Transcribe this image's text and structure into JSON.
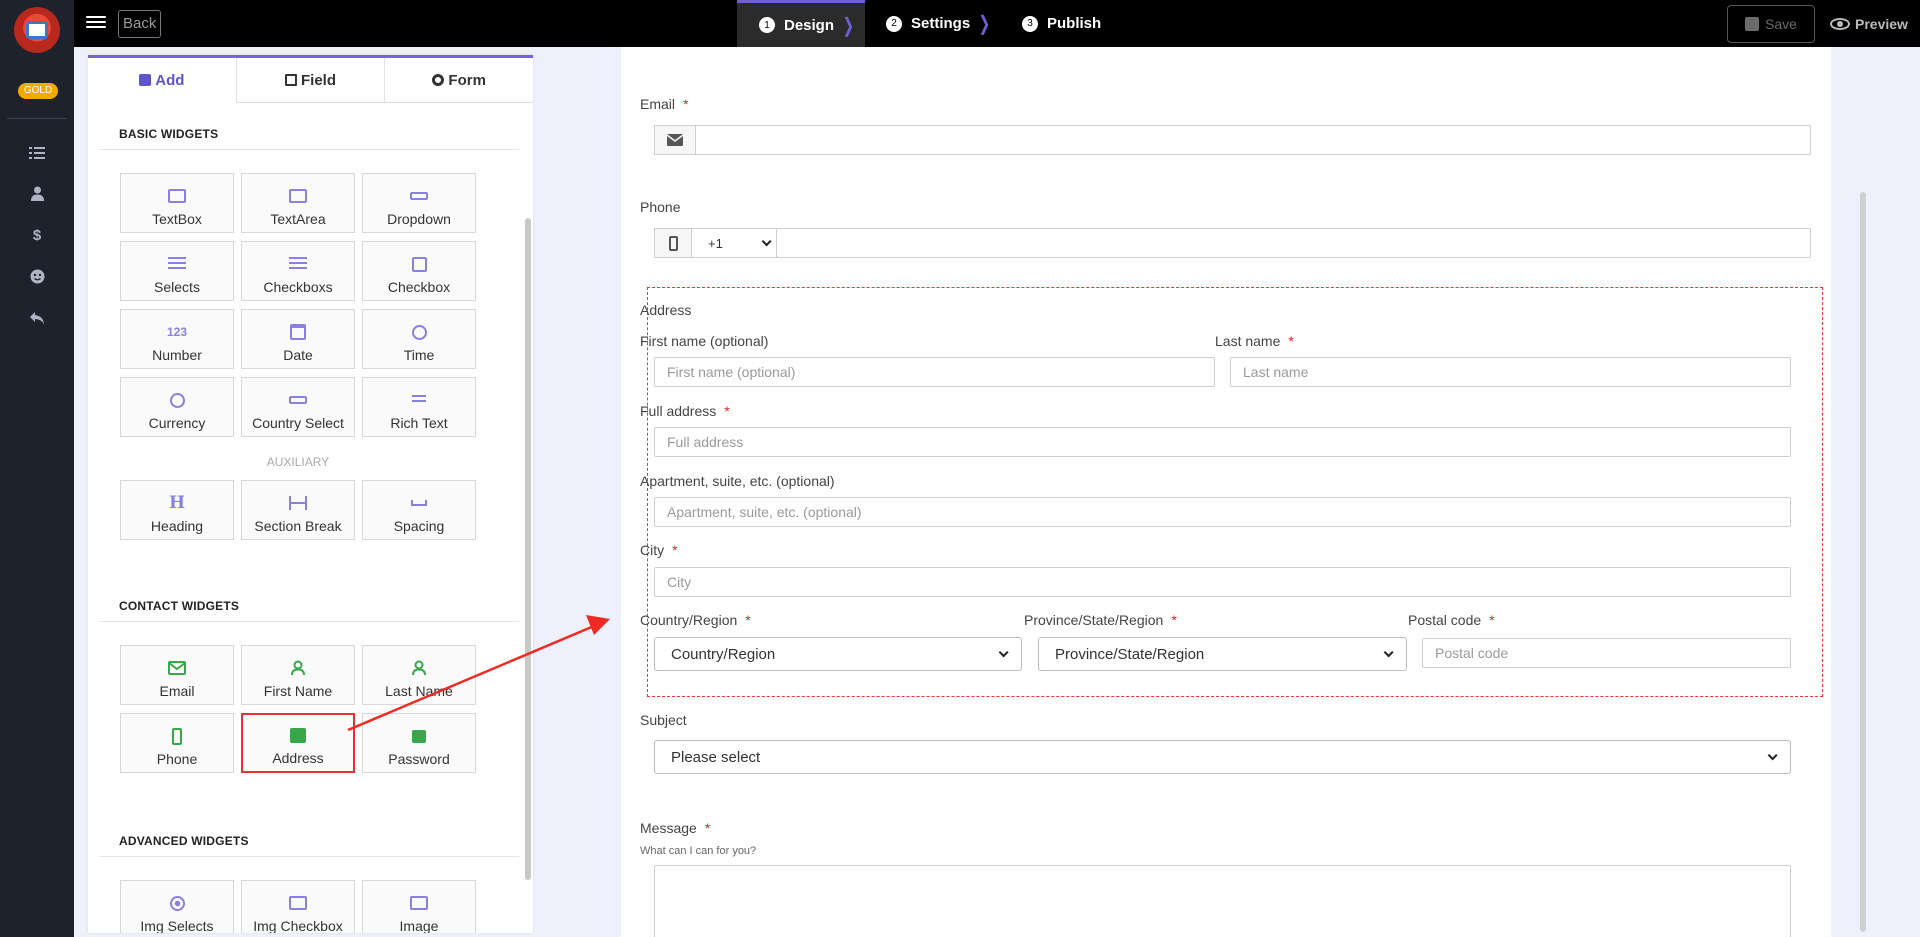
{
  "topbar": {
    "back_label": "Back",
    "steps": [
      {
        "num": "1",
        "label": "Design"
      },
      {
        "num": "2",
        "label": "Settings"
      },
      {
        "num": "3",
        "label": "Publish"
      }
    ],
    "save_label": "Save",
    "preview_label": "Preview"
  },
  "rail": {
    "badge": "GOLD",
    "icons": [
      "list-icon",
      "user-icon",
      "dollar-icon",
      "smile-icon",
      "undo-icon"
    ]
  },
  "panel": {
    "tabs": [
      "Add",
      "Field",
      "Form"
    ],
    "basic_heading": "BASIC WIDGETS",
    "basic_widgets": [
      "TextBox",
      "TextArea",
      "Dropdown",
      "Selects",
      "Checkboxs",
      "Checkbox",
      "Number",
      "Date",
      "Time",
      "Currency",
      "Country Select",
      "Rich Text"
    ],
    "number_glyph": "123",
    "auxiliary_heading": "AUXILIARY",
    "auxiliary_widgets": [
      "Heading",
      "Section Break",
      "Spacing"
    ],
    "heading_glyph": "H",
    "contact_heading": "CONTACT WIDGETS",
    "contact_widgets": [
      "Email",
      "First Name",
      "Last Name",
      "Phone",
      "Address",
      "Password"
    ],
    "advanced_heading": "ADVANCED WIDGETS",
    "advanced_widgets": [
      "Img Selects",
      "Img Checkbox",
      "Image"
    ]
  },
  "form": {
    "email_label": "Email",
    "phone_label": "Phone",
    "phone_code": "+1",
    "address_label": "Address",
    "first_name_label": "First name (optional)",
    "first_name_placeholder": "First name (optional)",
    "last_name_label": "Last name",
    "last_name_placeholder": "Last name",
    "full_address_label": "Full address",
    "full_address_placeholder": "Full address",
    "apartment_label": "Apartment, suite, etc. (optional)",
    "apartment_placeholder": "Apartment, suite, etc. (optional)",
    "city_label": "City",
    "city_placeholder": "City",
    "country_label": "Country/Region",
    "country_value": "Country/Region",
    "province_label": "Province/State/Region",
    "province_value": "Province/State/Region",
    "postal_label": "Postal code",
    "postal_placeholder": "Postal code",
    "subject_label": "Subject",
    "subject_value": "Please select",
    "message_label": "Message",
    "message_help": "What can I can for you?",
    "required_mark": "*"
  },
  "colors": {
    "accent": "#6f5fd6",
    "highlight": "#e6322e",
    "contact_icon": "#3aa64c",
    "badge": "#f2a900"
  }
}
